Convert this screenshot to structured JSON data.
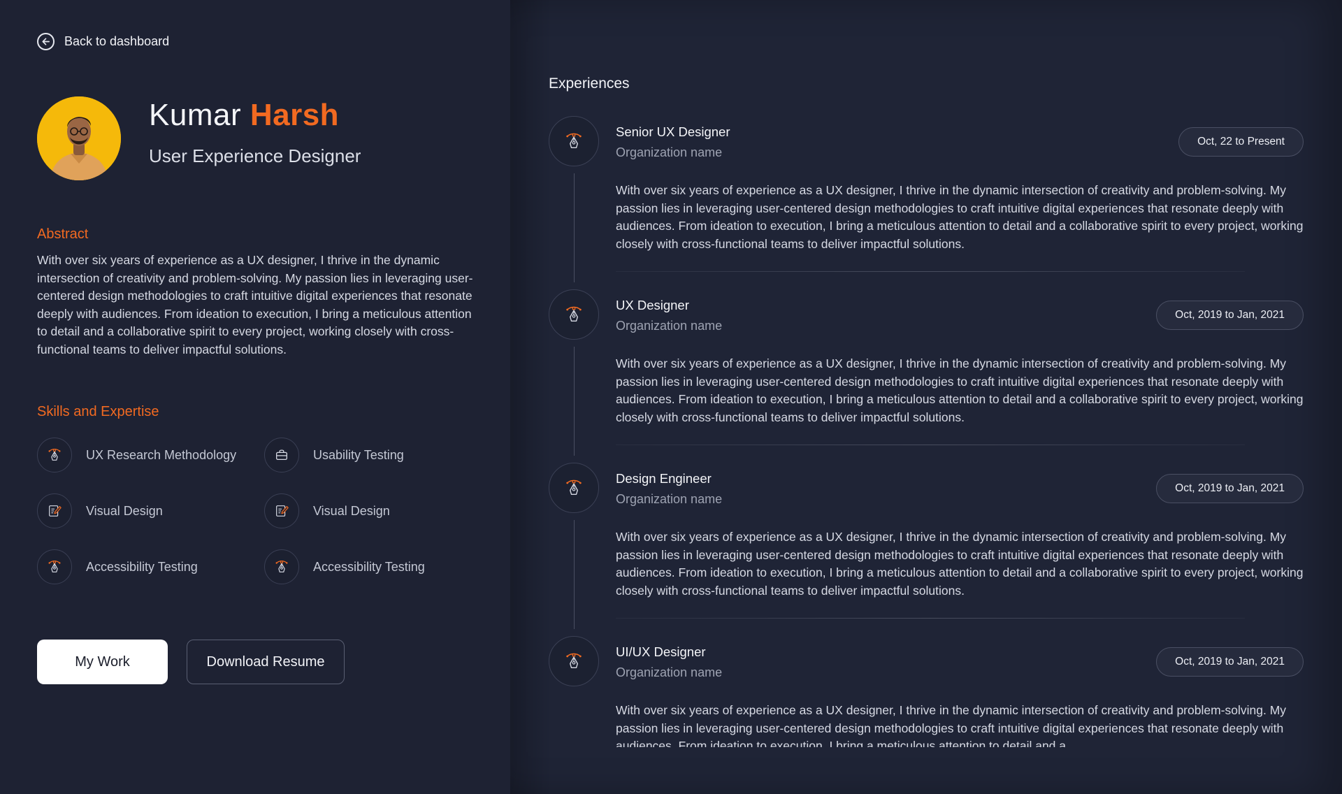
{
  "nav": {
    "back_label": "Back to dashboard"
  },
  "profile": {
    "first_name": "Kumar",
    "last_name": "Harsh",
    "title": "User Experience Designer"
  },
  "abstract": {
    "heading": "Abstract",
    "text": "With over six years of experience as a UX designer, I thrive in the dynamic intersection of creativity and problem-solving. My passion lies in leveraging user-centered design methodologies to craft intuitive digital experiences that resonate deeply with audiences. From ideation to execution, I bring a meticulous attention to detail and a collaborative spirit to every project, working closely with cross-functional teams to deliver impactful solutions."
  },
  "skills": {
    "heading": "Skills and Expertise",
    "items": [
      {
        "label": "UX Research Methodology",
        "icon": "pen-tool-icon"
      },
      {
        "label": "Usability Testing",
        "icon": "briefcase-icon"
      },
      {
        "label": "Visual Design",
        "icon": "edit-note-icon"
      },
      {
        "label": "Visual Design",
        "icon": "edit-note-icon"
      },
      {
        "label": "Accessibility Testing",
        "icon": "pen-tool-icon"
      },
      {
        "label": "Accessibility Testing",
        "icon": "pen-tool-icon"
      }
    ]
  },
  "actions": {
    "my_work": "My Work",
    "download_resume": "Download Resume"
  },
  "experiences": {
    "heading": "Experiences",
    "items": [
      {
        "role": "Senior UX Designer",
        "org": "Organization name",
        "date": "Oct, 22  to Present",
        "desc": "With over six years of experience as a UX designer, I thrive in the dynamic intersection of creativity and problem-solving. My passion lies in leveraging user-centered design methodologies to craft intuitive digital experiences that resonate deeply with audiences. From ideation to execution, I bring a meticulous attention to detail and a collaborative spirit to every project, working closely with cross-functional teams to deliver impactful solutions."
      },
      {
        "role": "UX Designer",
        "org": "Organization name",
        "date": "Oct, 2019  to Jan, 2021",
        "desc": "With over six years of experience as a UX designer, I thrive in the dynamic intersection of creativity and problem-solving. My passion lies in leveraging user-centered design methodologies to craft intuitive digital experiences that resonate deeply with audiences. From ideation to execution, I bring a meticulous attention to detail and a collaborative spirit to every project, working closely with cross-functional teams to deliver impactful solutions."
      },
      {
        "role": "Design Engineer",
        "org": "Organization name",
        "date": "Oct, 2019  to Jan, 2021",
        "desc": "With over six years of experience as a UX designer, I thrive in the dynamic intersection of creativity and problem-solving. My passion lies in leveraging user-centered design methodologies to craft intuitive digital experiences that resonate deeply with audiences. From ideation to execution, I bring a meticulous attention to detail and a collaborative spirit to every project, working closely with cross-functional teams to deliver impactful solutions."
      },
      {
        "role": "UI/UX Designer",
        "org": "Organization name",
        "date": "Oct, 2019  to Jan, 2021",
        "desc": "With over six years of experience as a UX designer, I thrive in the dynamic intersection of creativity and problem-solving. My passion lies in leveraging user-centered design methodologies to craft intuitive digital experiences that resonate deeply with audiences. From ideation to execution, I bring a meticulous attention to detail and a"
      }
    ]
  },
  "colors": {
    "accent": "#f26a21",
    "bg_left": "#1e2233",
    "bg_right": "#1f2436",
    "avatar_bg": "#f5b90a"
  }
}
